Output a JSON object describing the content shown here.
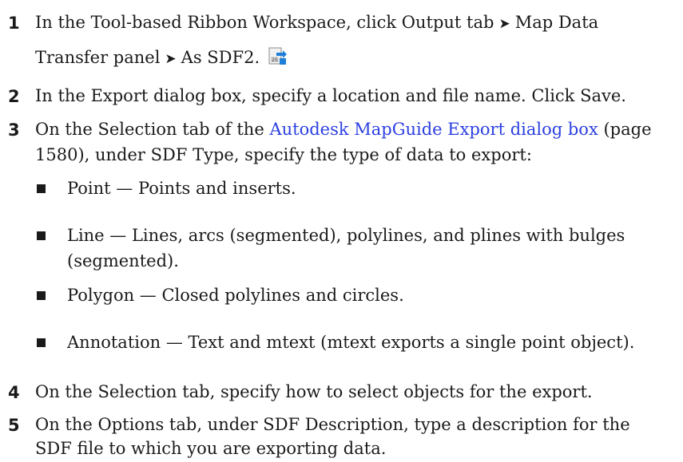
{
  "steps": [
    {
      "num": "1",
      "line1_a": "In the Tool-based Ribbon Workspace, click Output tab",
      "line1_b": "Map Data",
      "line2_a": "Transfer panel",
      "line2_b": "As SDF2.",
      "icon": "sdf-export-icon"
    },
    {
      "num": "2",
      "text": "In the Export dialog box, specify a location and file name. Click Save."
    },
    {
      "num": "3",
      "line1_a": "On the Selection tab of the ",
      "link": "Autodesk MapGuide Export dialog box",
      "line1_b": " (page",
      "line2": "1580), under SDF Type, specify the type of data to export:",
      "bullets": [
        {
          "lines": [
            "Point — Points and inserts."
          ]
        },
        {
          "lines": [
            "Line — Lines, arcs (segmented), polylines, and plines with bulges",
            "(segmented)."
          ]
        },
        {
          "lines": [
            "Polygon — Closed polylines and circles."
          ]
        },
        {
          "lines": [
            "Annotation — Text and mtext (mtext exports a single point object)."
          ]
        }
      ]
    },
    {
      "num": "4",
      "text": "On the Selection tab, specify how to select objects for the export."
    },
    {
      "num": "5",
      "line1": "On the Options tab, under SDF Description, type a description for the",
      "line2": "SDF file to which you are exporting data."
    }
  ],
  "arrow_glyph": "➤",
  "colors": {
    "text": "#1a1a1a",
    "link": "#2b3fe0",
    "icon_blue": "#1e7fd8"
  }
}
